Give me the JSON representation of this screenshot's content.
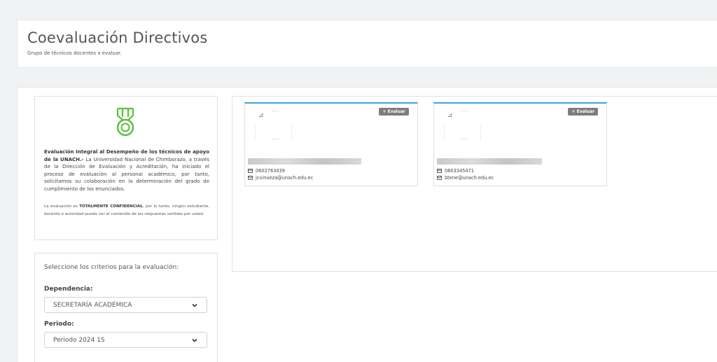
{
  "header": {
    "title": "Coevaluación Directivos",
    "subtitle": "Grupo de técnicos docentes a evaluar."
  },
  "info": {
    "title_bold": "Evaluación Integral al Desempeño de los técnicos de apoyo de la UNACH.-",
    "body": " La Universidad Nacional de Chimborazo, a través de la Dirección de Evaluación y Acreditación, ha iniciado el proceso de evaluación al personal académico, por tanto, solicitamos su colaboración en la determinación del grado de cumplimiento de los enunciados.",
    "note_pre": "La evaluación es ",
    "note_bold": "TOTALMENTE CONFIDENCIAL",
    "note_post": ", por lo tanto, ningún estudiante, docente o autoridad puede ver el contenido de las respuestas vertidas por usted.",
    "icon": "medal-icon"
  },
  "criteria": {
    "title": "Seleccione los criterios para la evaluación:",
    "dependencia_label": "Dependencia:",
    "dependencia_value": "SECRETARÍA ACADÉMICA",
    "periodo_label": "Periodo:",
    "periodo_value": "Periodo 2024 1S"
  },
  "cards": [
    {
      "button": "+ Evaluar",
      "phone": "0602763039",
      "email": "jcvinueza@unach.edu.ec"
    },
    {
      "button": "+ Evaluar",
      "phone": "0603345471",
      "email": "btene@unach.edu.ec"
    }
  ],
  "colors": {
    "accent_blue": "#3ea0e6",
    "medal_green": "#5cbf3c",
    "button_gray": "#7b7d80"
  }
}
